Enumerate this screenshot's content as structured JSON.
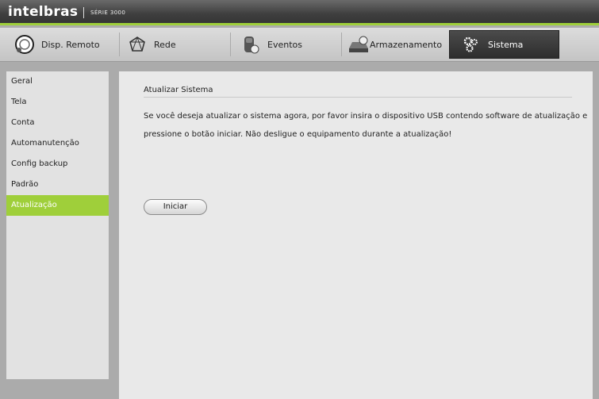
{
  "header": {
    "brand": "intelbras",
    "series": "SÉRIE 3000"
  },
  "tabs": [
    {
      "label": "Disp. Remoto",
      "icon": "remote-device-icon",
      "active": false
    },
    {
      "label": "Rede",
      "icon": "network-icon",
      "active": false
    },
    {
      "label": "Eventos",
      "icon": "events-icon",
      "active": false
    },
    {
      "label": "Armazenamento",
      "icon": "storage-icon",
      "active": false
    },
    {
      "label": "Sistema",
      "icon": "gears-icon",
      "active": true
    }
  ],
  "sidebar": {
    "items": [
      {
        "label": "Geral"
      },
      {
        "label": "Tela"
      },
      {
        "label": "Conta"
      },
      {
        "label": "Automanutenção"
      },
      {
        "label": "Config backup"
      },
      {
        "label": "Padrão"
      },
      {
        "label": "Atualização",
        "active": true
      }
    ]
  },
  "main": {
    "section_title": "Atualizar Sistema",
    "message": "Se você deseja atualizar o sistema agora, por favor insira o dispositivo USB contendo software de atualização e pressione o botão iniciar. Não desligue o equipamento durante a atualização!",
    "start_button": "Iniciar"
  },
  "colors": {
    "accent": "#9fcf3a",
    "active_tab": "#333333",
    "panel": "#e9e9e9"
  }
}
